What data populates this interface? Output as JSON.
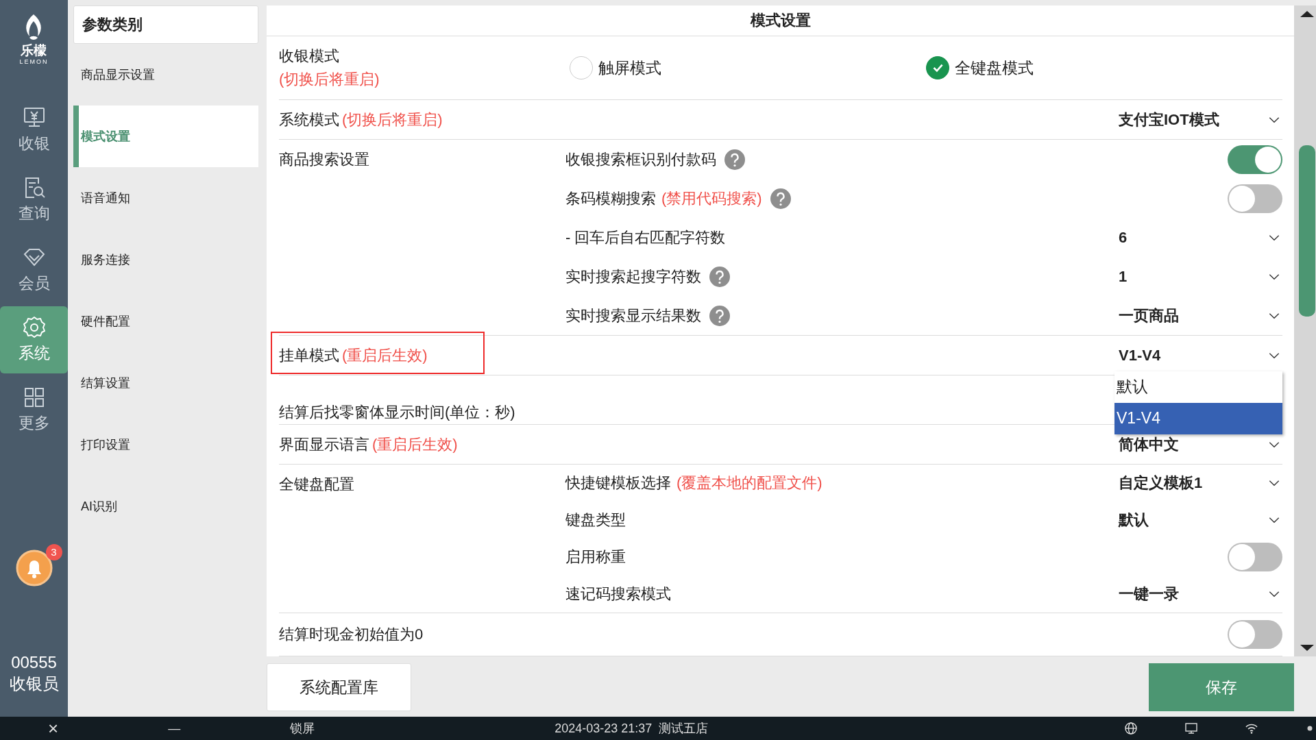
{
  "rail": {
    "logo": {
      "name": "乐檬",
      "sub": "LEMON"
    },
    "items": [
      {
        "label": "收银",
        "selected": false
      },
      {
        "label": "查询",
        "selected": false
      },
      {
        "label": "会员",
        "selected": false
      },
      {
        "label": "系统",
        "selected": true
      },
      {
        "label": "更多",
        "selected": false
      }
    ],
    "notifications": {
      "count": "3"
    },
    "user": {
      "id": "00555",
      "role": "收银员"
    }
  },
  "categories": {
    "title": "参数类别",
    "items": [
      {
        "label": "商品显示设置",
        "selected": false
      },
      {
        "label": "模式设置",
        "selected": true
      },
      {
        "label": "语音通知",
        "selected": false
      },
      {
        "label": "服务连接",
        "selected": false
      },
      {
        "label": "硬件配置",
        "selected": false
      },
      {
        "label": "结算设置",
        "selected": false
      },
      {
        "label": "打印设置",
        "selected": false
      },
      {
        "label": "AI识别",
        "selected": false
      }
    ]
  },
  "panel": {
    "title": "模式设置",
    "rows": [
      {
        "kind": "radio",
        "label": "收银模式",
        "note": "(切换后将重启)",
        "options": [
          {
            "label": "触屏模式",
            "selected": false
          },
          {
            "label": "全键盘模式",
            "selected": true
          }
        ]
      },
      {
        "kind": "select",
        "label": "系统模式",
        "note": "(切换后将重启)",
        "value": "支付宝IOT模式"
      },
      {
        "kind": "group",
        "label": "商品搜索设置",
        "children": [
          {
            "kind": "toggle",
            "label": "收银搜索框识别付款码",
            "help": true,
            "on": true
          },
          {
            "kind": "toggle",
            "label": "条码模糊搜索",
            "note": "(禁用代码搜索)",
            "help": true,
            "on": false
          },
          {
            "kind": "select",
            "label": "- 回车后自右匹配字符数",
            "value": "6"
          },
          {
            "kind": "select",
            "label": "实时搜索起搜字符数",
            "help": true,
            "value": "1"
          },
          {
            "kind": "select",
            "label": "实时搜索显示结果数",
            "help": true,
            "value": "一页商品"
          }
        ]
      },
      {
        "kind": "select",
        "label": "挂单模式",
        "note": "(重启后生效)",
        "value": "V1-V4",
        "highlighted": true,
        "menu": [
          {
            "label": "默认",
            "selected": false
          },
          {
            "label": "V1-V4",
            "selected": true
          }
        ]
      },
      {
        "kind": "text",
        "label": "结算后找零窗体显示时间(单位：秒)"
      },
      {
        "kind": "select",
        "label": "界面显示语言",
        "note": "(重启后生效)",
        "value": "简体中文"
      },
      {
        "kind": "group",
        "label": "全键盘配置",
        "children": [
          {
            "kind": "select",
            "label": "快捷键模板选择",
            "note": "(覆盖本地的配置文件)",
            "value": "自定义模板1"
          },
          {
            "kind": "select",
            "label": "键盘类型",
            "value": "默认"
          },
          {
            "kind": "toggle",
            "label": "启用称重",
            "on": false
          },
          {
            "kind": "select",
            "label": "速记码搜索模式",
            "value": "一键一录"
          }
        ]
      },
      {
        "kind": "toggle",
        "label": "结算时现金初始值为0",
        "on": false
      }
    ]
  },
  "footer": {
    "library_button": "系统配置库",
    "save_button": "保存"
  },
  "taskbar": {
    "close": "×",
    "minimize": "—",
    "lock": "锁屏",
    "datetime": "2024-03-23 21:37",
    "store": "测试五店"
  }
}
